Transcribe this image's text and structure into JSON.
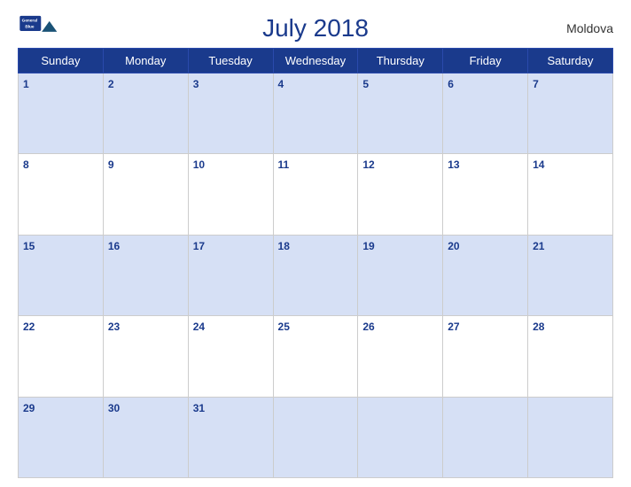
{
  "header": {
    "title": "July 2018",
    "country": "Moldova",
    "logo": {
      "line1": "General",
      "line2": "Blue"
    }
  },
  "weekdays": [
    "Sunday",
    "Monday",
    "Tuesday",
    "Wednesday",
    "Thursday",
    "Friday",
    "Saturday"
  ],
  "weeks": [
    [
      1,
      2,
      3,
      4,
      5,
      6,
      7
    ],
    [
      8,
      9,
      10,
      11,
      12,
      13,
      14
    ],
    [
      15,
      16,
      17,
      18,
      19,
      20,
      21
    ],
    [
      22,
      23,
      24,
      25,
      26,
      27,
      28
    ],
    [
      29,
      30,
      31,
      null,
      null,
      null,
      null
    ]
  ]
}
